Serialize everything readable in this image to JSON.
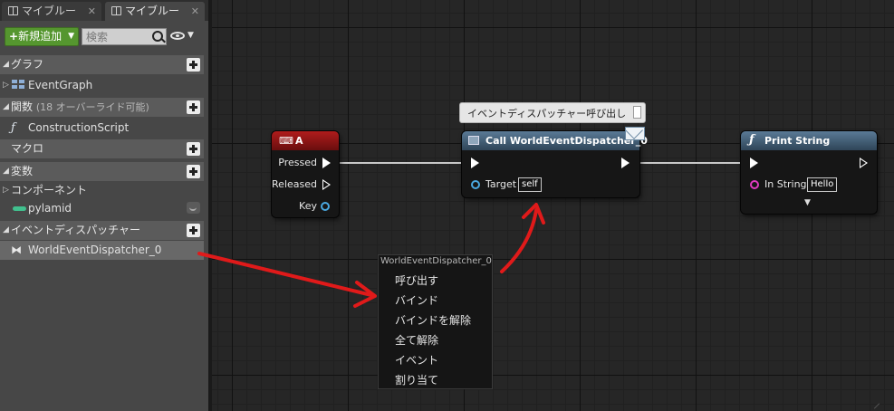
{
  "tabs": [
    {
      "label": "マイブルー",
      "close": "✕"
    },
    {
      "label": "マイブルー",
      "close": "✕"
    }
  ],
  "toolbar": {
    "add_label": "新規追加",
    "search_placeholder": "検索"
  },
  "sections": {
    "graph": {
      "label": "グラフ",
      "items": [
        "EventGraph"
      ]
    },
    "functions": {
      "label": "関数",
      "sub": "(18 オーバーライド可能)",
      "items": [
        "ConstructionScript"
      ]
    },
    "macros": {
      "label": "マクロ"
    },
    "variables": {
      "label": "変数",
      "group": "コンポーネント",
      "items": [
        "pylamid"
      ]
    },
    "dispatchers": {
      "label": "イベントディスパッチャー",
      "items": [
        "WorldEventDispatcher_0"
      ]
    }
  },
  "nodes": {
    "key_a": {
      "title": "A",
      "pins": [
        "Pressed",
        "Released",
        "Key"
      ],
      "color": "#8e1414"
    },
    "call": {
      "title": "Call WorldEventDispatcher_0",
      "target_label": "Target",
      "target_value": "self",
      "color": "#45627c"
    },
    "print": {
      "title": "Print String",
      "in_label": "In String",
      "in_value": "Hello",
      "color": "#45627c"
    }
  },
  "tooltip": "イベントディスパッチャー呼び出し",
  "context_menu": {
    "title": "WorldEventDispatcher_0",
    "items": [
      "呼び出す",
      "バインド",
      "バインドを解除",
      "全て解除",
      "イベント",
      "割り当て"
    ]
  },
  "annotation_color": "#e01a1a"
}
